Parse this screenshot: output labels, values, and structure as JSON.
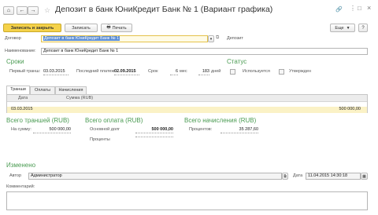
{
  "window": {
    "title": "Депозит в банк ЮниКредит Банк № 1 (Вариант графика)"
  },
  "toolbar": {
    "save_close": "Записать и закрыть",
    "save": "Записать",
    "print": "Печать",
    "more": "Еще",
    "help": "?"
  },
  "form": {
    "contract_label": "Договор",
    "contract_value": "Депозит в банк ЮниКредит Банк № 1",
    "contract_link": "Депозит",
    "name_label": "Наименование:",
    "name_value": "Депозит в банк ЮниКредит Банк № 1"
  },
  "terms": {
    "heading": "Сроки",
    "first_label": "Первый транш:",
    "first_value": "03.03.2015",
    "last_label": "Последний платеж:",
    "last_value": "02.09.2015",
    "term_label": "Срок",
    "term_months": "6",
    "months_unit": "мес",
    "term_days": "183",
    "days_unit": "дней"
  },
  "status": {
    "heading": "Статус",
    "used": "Используется",
    "approved": "Утвержден"
  },
  "tabs": [
    "Транши",
    "Оплаты",
    "Начисления"
  ],
  "table": {
    "col_date": "Дата",
    "col_amount": "Сумма (RUB)",
    "rows": [
      {
        "date": "03.03.2015",
        "amount": "500 000,00"
      }
    ]
  },
  "totals": {
    "tranches_heading": "Всего траншей (RUB)",
    "tranches_label": "На сумму:",
    "tranches_value": "500 000,00",
    "payments_heading": "Всего оплата (RUB)",
    "principal_label": "Основной долг",
    "principal_value": "500 000,00",
    "interest_label": "Проценты",
    "accrual_heading": "Всего начисления (RUB)",
    "accrual_label": "Процентов:",
    "accrual_value": "35 287,60"
  },
  "changed": {
    "heading": "Изменено",
    "author_label": "Автор",
    "author_value": "Администратор",
    "date_label": "Дата",
    "date_value": "11.04.2015 14:30:18",
    "comment_label": "Комментарий:"
  },
  "colors": {
    "section": "#4a9b52",
    "primary_button": "#f5d24a",
    "selected_row": "#fbf2c6"
  }
}
